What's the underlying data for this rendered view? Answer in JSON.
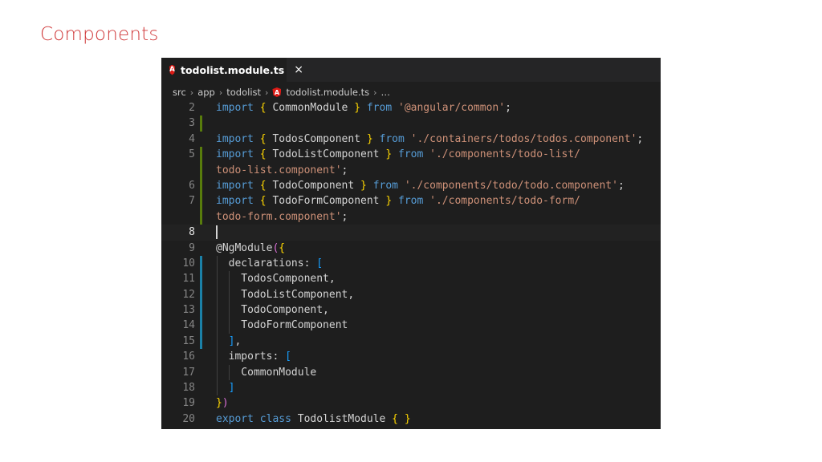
{
  "slide": {
    "title": "Components"
  },
  "editor": {
    "tab": {
      "label": "todolist.module.ts",
      "close": "×",
      "icon": "angular-icon"
    },
    "breadcrumb": [
      "src",
      "app",
      "todolist",
      "todolist.module.ts",
      "…"
    ],
    "lines": [
      {
        "num": "2",
        "marker": "",
        "segments": [
          [
            "kw",
            "import "
          ],
          [
            "br1",
            "{ "
          ],
          [
            "id",
            "CommonModule "
          ],
          [
            "br1",
            "} "
          ],
          [
            "kw",
            "from "
          ],
          [
            "str",
            "'@angular/common'"
          ],
          [
            "pl",
            ";"
          ]
        ]
      },
      {
        "num": "3",
        "marker": "added",
        "segments": []
      },
      {
        "num": "4",
        "marker": "",
        "segments": [
          [
            "kw",
            "import "
          ],
          [
            "br1",
            "{ "
          ],
          [
            "id",
            "TodosComponent "
          ],
          [
            "br1",
            "} "
          ],
          [
            "kw",
            "from "
          ],
          [
            "str",
            "'./containers/todos/todos.component'"
          ],
          [
            "pl",
            ";"
          ]
        ]
      },
      {
        "num": "5",
        "marker": "added",
        "segments": [
          [
            "kw",
            "import "
          ],
          [
            "br1",
            "{ "
          ],
          [
            "id",
            "TodoListComponent "
          ],
          [
            "br1",
            "} "
          ],
          [
            "kw",
            "from "
          ],
          [
            "str",
            "'./components/todo-list/"
          ]
        ]
      },
      {
        "num": "",
        "marker": "added",
        "segments": [
          [
            "str",
            "todo-list.component'"
          ],
          [
            "pl",
            ";"
          ]
        ]
      },
      {
        "num": "6",
        "marker": "added",
        "segments": [
          [
            "kw",
            "import "
          ],
          [
            "br1",
            "{ "
          ],
          [
            "id",
            "TodoComponent "
          ],
          [
            "br1",
            "} "
          ],
          [
            "kw",
            "from "
          ],
          [
            "str",
            "'./components/todo/todo.component'"
          ],
          [
            "pl",
            ";"
          ]
        ]
      },
      {
        "num": "7",
        "marker": "added",
        "segments": [
          [
            "kw",
            "import "
          ],
          [
            "br1",
            "{ "
          ],
          [
            "id",
            "TodoFormComponent "
          ],
          [
            "br1",
            "} "
          ],
          [
            "kw",
            "from "
          ],
          [
            "str",
            "'./components/todo-form/"
          ]
        ]
      },
      {
        "num": "",
        "marker": "added",
        "segments": [
          [
            "str",
            "todo-form.component'"
          ],
          [
            "pl",
            ";"
          ]
        ]
      },
      {
        "num": "8",
        "marker": "",
        "current": true,
        "cursor": true,
        "segments": []
      },
      {
        "num": "9",
        "marker": "",
        "segments": [
          [
            "pl",
            "@NgModule"
          ],
          [
            "br2",
            "("
          ],
          [
            "br1",
            "{"
          ]
        ]
      },
      {
        "num": "10",
        "marker": "modified",
        "indent": 1,
        "segments": [
          [
            "pl",
            "  declarations: "
          ],
          [
            "br3",
            "["
          ]
        ]
      },
      {
        "num": "11",
        "marker": "modified",
        "indent": 2,
        "segments": [
          [
            "pl",
            "    TodosComponent,"
          ]
        ]
      },
      {
        "num": "12",
        "marker": "modified",
        "indent": 2,
        "segments": [
          [
            "pl",
            "    TodoListComponent,"
          ]
        ]
      },
      {
        "num": "13",
        "marker": "modified",
        "indent": 2,
        "segments": [
          [
            "pl",
            "    TodoComponent,"
          ]
        ]
      },
      {
        "num": "14",
        "marker": "modified",
        "indent": 2,
        "segments": [
          [
            "pl",
            "    TodoFormComponent"
          ]
        ]
      },
      {
        "num": "15",
        "marker": "modified",
        "indent": 1,
        "segments": [
          [
            "pl",
            "  "
          ],
          [
            "br3",
            "]"
          ],
          [
            "pl",
            ","
          ]
        ]
      },
      {
        "num": "16",
        "marker": "",
        "indent": 1,
        "segments": [
          [
            "pl",
            "  imports: "
          ],
          [
            "br3",
            "["
          ]
        ]
      },
      {
        "num": "17",
        "marker": "",
        "indent": 2,
        "segments": [
          [
            "pl",
            "    CommonModule"
          ]
        ]
      },
      {
        "num": "18",
        "marker": "",
        "indent": 1,
        "segments": [
          [
            "pl",
            "  "
          ],
          [
            "br3",
            "]"
          ]
        ]
      },
      {
        "num": "19",
        "marker": "",
        "segments": [
          [
            "br1",
            "}"
          ],
          [
            "br2",
            ")"
          ]
        ]
      },
      {
        "num": "20",
        "marker": "",
        "segments": [
          [
            "kw",
            "export "
          ],
          [
            "kw",
            "class "
          ],
          [
            "id",
            "TodolistModule "
          ],
          [
            "br1",
            "{ }"
          ]
        ]
      }
    ]
  },
  "colors": {
    "kw": "#569cd6",
    "id": "#d4d4d4",
    "str": "#ce9178",
    "pl": "#d4d4d4",
    "br1": "#ffd700",
    "br2": "#da70d6",
    "br3": "#179fff"
  }
}
